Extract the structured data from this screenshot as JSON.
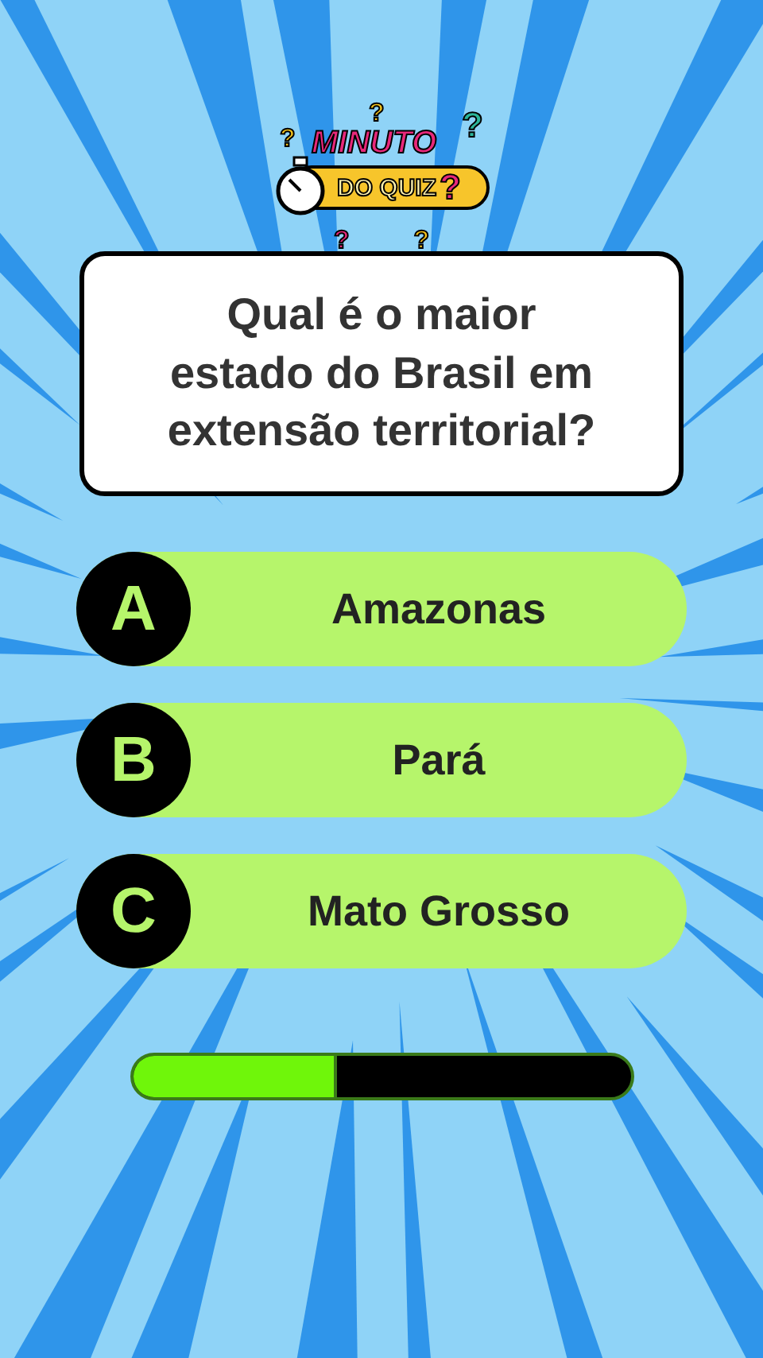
{
  "logo": {
    "top": "MINUTO",
    "bottom": "DO QUIZ",
    "mark": "?",
    "decorations": [
      "?",
      "?",
      "?",
      "?",
      "?"
    ]
  },
  "question": "Qual é o maior estado do Brasil em extensão territorial?",
  "options": [
    {
      "letter": "A",
      "text": "Amazonas"
    },
    {
      "letter": "B",
      "text": "Pará"
    },
    {
      "letter": "C",
      "text": "Mato Grosso"
    }
  ],
  "timer": {
    "level": 0.41
  }
}
